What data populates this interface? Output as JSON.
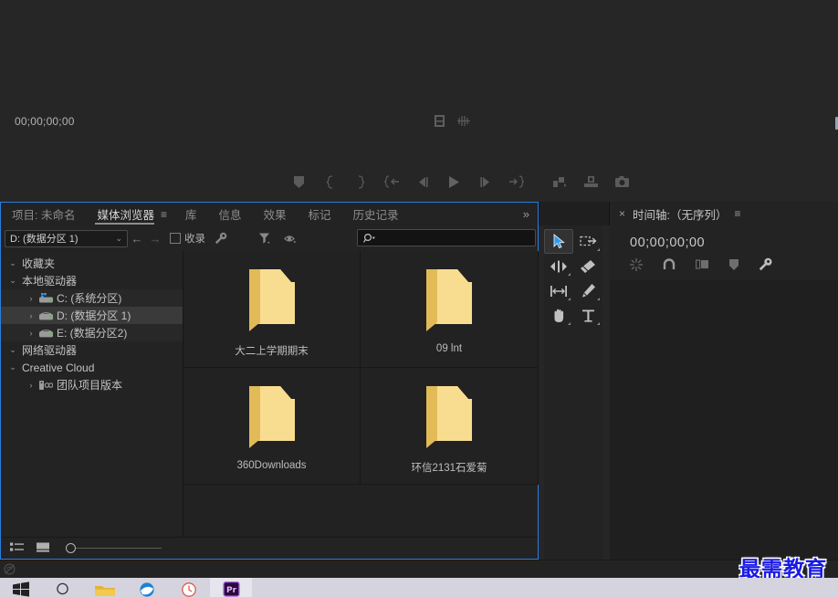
{
  "monitor": {
    "timecode": "00;00;00;00",
    "mid_icons": [
      {
        "name": "film-strip-icon"
      },
      {
        "name": "audio-waveform-icon"
      }
    ],
    "transport": [
      {
        "name": "add-marker-button",
        "glyph": "marker"
      },
      {
        "name": "mark-in-button",
        "glyph": "{"
      },
      {
        "name": "mark-out-button",
        "glyph": "}"
      },
      {
        "name": "go-to-in-button",
        "glyph": "{<"
      },
      {
        "name": "step-back-button",
        "glyph": "<|"
      },
      {
        "name": "play-stop-button",
        "glyph": "play"
      },
      {
        "name": "step-forward-button",
        "glyph": "|>"
      },
      {
        "name": "go-to-out-button",
        "glyph": "->}"
      },
      {
        "name": "lift-button",
        "glyph": "lift"
      },
      {
        "name": "extract-button",
        "glyph": "extract"
      },
      {
        "name": "export-frame-button",
        "glyph": "camera"
      }
    ]
  },
  "tabs": {
    "items": [
      {
        "label": "项目: 未命名",
        "active": false
      },
      {
        "label": "媒体浏览器",
        "active": true
      },
      {
        "label": "库",
        "active": false
      },
      {
        "label": "信息",
        "active": false
      },
      {
        "label": "效果",
        "active": false
      },
      {
        "label": "标记",
        "active": false
      },
      {
        "label": "历史记录",
        "active": false
      }
    ],
    "overflow_label": "»",
    "panel_menu_label": "≡"
  },
  "media_browser": {
    "drive_select": {
      "value": "D: (数据分区 1)",
      "chevron": "⌄"
    },
    "nav": {
      "back": "←",
      "forward": "→"
    },
    "ingest_label": "收录",
    "toolbar_icons": [
      {
        "name": "wrench-icon"
      },
      {
        "name": "filter-icon"
      },
      {
        "name": "visibility-icon"
      }
    ],
    "search": {
      "placeholder": "",
      "value": ""
    },
    "tree": [
      {
        "label": "收藏夹",
        "level": 0,
        "twisty": "⌄",
        "icon": "",
        "selected": false
      },
      {
        "label": "本地驱动器",
        "level": 0,
        "twisty": "⌄",
        "icon": "",
        "selected": false
      },
      {
        "label": "C: (系统分区)",
        "level": 1,
        "twisty": "›",
        "icon": "drive-system-icon",
        "selected": false,
        "alt": true
      },
      {
        "label": "D: (数据分区 1)",
        "level": 1,
        "twisty": "›",
        "icon": "drive-icon",
        "selected": true
      },
      {
        "label": "E: (数据分区2)",
        "level": 1,
        "twisty": "›",
        "icon": "drive-icon",
        "selected": false,
        "alt": true
      },
      {
        "label": "网络驱动器",
        "level": 0,
        "twisty": "⌄",
        "icon": "",
        "selected": false
      },
      {
        "label": "Creative Cloud",
        "level": 0,
        "twisty": "⌄",
        "icon": "",
        "selected": false
      },
      {
        "label": "团队项目版本",
        "level": 1,
        "twisty": "›",
        "icon": "team-project-icon",
        "selected": false
      }
    ],
    "items": [
      {
        "name": "大二上学期期末",
        "type": "folder"
      },
      {
        "name": "09 lnt",
        "type": "folder"
      },
      {
        "name": "360Downloads",
        "type": "folder"
      },
      {
        "name": "环信2131石爱菊",
        "type": "folder"
      }
    ],
    "status_icons": [
      {
        "name": "list-view-icon"
      },
      {
        "name": "thumbnail-view-icon"
      }
    ],
    "zoom_slider": {
      "value": 0
    }
  },
  "tools": {
    "items": [
      {
        "name": "selection-tool",
        "active": true
      },
      {
        "name": "track-select-forward-tool",
        "active": false
      },
      {
        "name": "ripple-edit-tool",
        "active": false
      },
      {
        "name": "slip-tool",
        "active": false
      },
      {
        "name": "rate-stretch-tool",
        "active": false
      },
      {
        "name": "pen-tool",
        "active": false
      },
      {
        "name": "hand-tool",
        "active": false
      },
      {
        "name": "type-tool",
        "active": false
      }
    ]
  },
  "timeline": {
    "close_label": "×",
    "title": "时间轴:（无序列）",
    "menu_label": "≡",
    "timecode": "00;00;00;00",
    "icons": [
      {
        "name": "nest-sequence-icon"
      },
      {
        "name": "snap-magnet-icon"
      },
      {
        "name": "linked-selection-icon"
      },
      {
        "name": "add-marker-icon"
      },
      {
        "name": "timeline-settings-wrench-icon"
      }
    ]
  },
  "statusbar": {
    "icon": "no-sync-icon"
  },
  "taskbar": {
    "items": [
      {
        "name": "windows-start-button"
      },
      {
        "name": "search-button"
      },
      {
        "name": "file-explorer-button"
      },
      {
        "name": "browser-button"
      },
      {
        "name": "clock-app-button"
      },
      {
        "name": "premiere-pro-button",
        "active": true
      }
    ]
  },
  "watermark": {
    "text": "最需教育",
    "color": "#1a1ae6"
  },
  "colors": {
    "accent": "#2a7de1",
    "panel_bg": "#232323",
    "app_bg": "#262626",
    "folder": "#f3d27e"
  }
}
